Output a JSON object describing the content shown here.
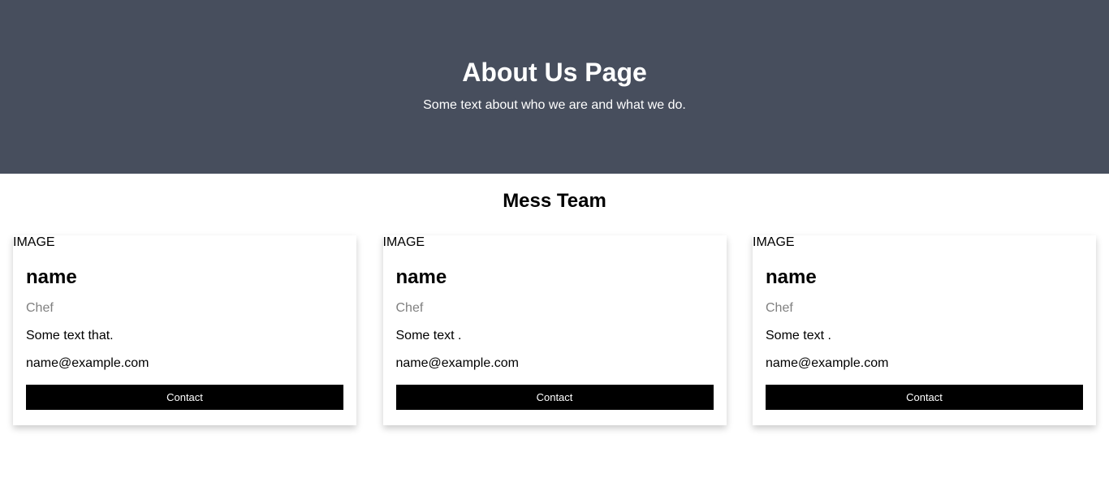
{
  "hero": {
    "title": "About Us Page",
    "subtitle": "Some text about who we are and what we do.",
    "background_color": "#474e5d"
  },
  "team": {
    "heading": "Mess Team",
    "members": [
      {
        "image_alt": "IMAGE",
        "name": "name",
        "role": "Chef",
        "description": "Some text that.",
        "email": "name@example.com",
        "button_label": "Contact"
      },
      {
        "image_alt": "IMAGE",
        "name": "name",
        "role": "Chef",
        "description": "Some text .",
        "email": "name@example.com",
        "button_label": "Contact"
      },
      {
        "image_alt": "IMAGE",
        "name": "name",
        "role": "Chef",
        "description": "Some text .",
        "email": "name@example.com",
        "button_label": "Contact"
      }
    ]
  },
  "colors": {
    "button_bg": "#000000",
    "button_text": "#ffffff",
    "role_text": "#808080"
  }
}
